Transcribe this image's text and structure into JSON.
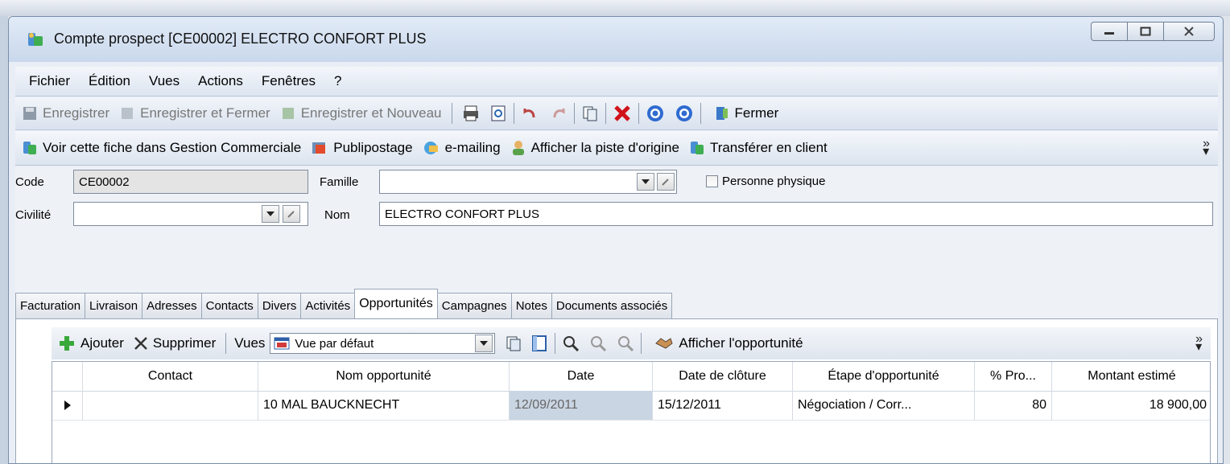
{
  "window": {
    "title": "Compte prospect [CE00002] ELECTRO CONFORT PLUS"
  },
  "menu": [
    "Fichier",
    "Édition",
    "Vues",
    "Actions",
    "Fenêtres",
    "?"
  ],
  "toolbar1": {
    "save": "Enregistrer",
    "save_close": "Enregistrer et Fermer",
    "save_new": "Enregistrer et Nouveau",
    "close": "Fermer"
  },
  "toolbar2": {
    "view_in_gc": "Voir cette fiche dans Gestion Commerciale",
    "mailing": "Publipostage",
    "emailing": "e-mailing",
    "show_origin": "Afficher la piste d'origine",
    "transfer": "Transférer en client"
  },
  "form": {
    "code_label": "Code",
    "code_value": "CE00002",
    "famille_label": "Famille",
    "famille_value": "",
    "personne_label": "Personne physique",
    "civilite_label": "Civilité",
    "civilite_value": "",
    "nom_label": "Nom",
    "nom_value": "ELECTRO CONFORT PLUS"
  },
  "tabs": [
    "Facturation",
    "Livraison",
    "Adresses",
    "Contacts",
    "Divers",
    "Activités",
    "Opportunités",
    "Campagnes",
    "Notes",
    "Documents associés"
  ],
  "active_tab": "Opportunités",
  "grid_toolbar": {
    "add": "Ajouter",
    "delete": "Supprimer",
    "views_label": "Vues",
    "view_value": "Vue par défaut",
    "show_opportunity": "Afficher l'opportunité"
  },
  "grid": {
    "columns": [
      "Contact",
      "Nom opportunité",
      "Date",
      "Date de clôture",
      "Étape d'opportunité",
      "% Pro...",
      "Montant estimé"
    ],
    "rows": [
      {
        "contact": "",
        "nom": "10 MAL BAUCKNECHT",
        "date": "12/09/2011",
        "cloture": "15/12/2011",
        "etape": "Négociation / Corr...",
        "pct": "80",
        "montant": "18 900,00"
      }
    ]
  }
}
